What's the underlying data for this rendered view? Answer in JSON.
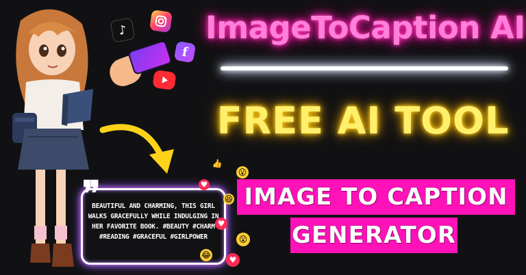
{
  "title": "ImageToCaption AI",
  "subtitle": "FREE AI TOOL",
  "banner": {
    "line1": "IMAGE TO CAPTION",
    "line2": "GENERATOR"
  },
  "caption_card": {
    "quote_mark": "❞",
    "text": "BEAUTIFUL AND CHARMING, THIS GIRL WALKS GRACEFULLY WHILE INDULGING IN HER FAVORITE BOOK. #BEAUTY #CHARM #READING #GRACEFUL #GIRLPOWER"
  },
  "social_icons": {
    "tiktok": "♪",
    "facebook": "f"
  },
  "colors": {
    "background": "#111113",
    "title_pink": "#ff7fd9",
    "subtitle_yellow": "#ffef6a",
    "banner_magenta": "#ff12b8",
    "arrow_yellow": "#ffd21a"
  },
  "icons": [
    "tiktok-icon",
    "instagram-icon",
    "facebook-icon",
    "youtube-icon",
    "phone-icon",
    "hand-icon",
    "curved-arrow-icon",
    "heart-icon",
    "surprised-emoji-icon",
    "laughing-emoji-icon",
    "like-icon"
  ]
}
